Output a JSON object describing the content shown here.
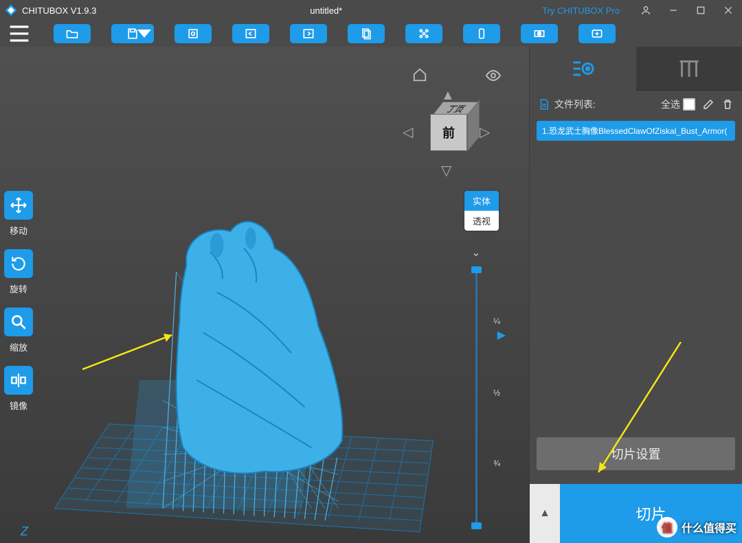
{
  "app": {
    "name": "CHITUBOX V1.9.3",
    "document": "untitled*",
    "tryPro": "Try CHITUBOX Pro"
  },
  "leftTools": {
    "move": "移动",
    "rotate": "旋转",
    "scale": "缩放",
    "mirror": "镜像"
  },
  "viewcube": {
    "front": "前",
    "top": "丁页"
  },
  "viewToggle": {
    "solid": "实体",
    "xray": "透视"
  },
  "slider": {
    "q1": "¼",
    "q2": "½",
    "q3": "¾"
  },
  "axis": {
    "z": "Z"
  },
  "side": {
    "fileListLabel": "文件列表:",
    "selectAll": "全选",
    "file1": "1.恐龙武士胸像BlessedClawOfZiskal_Bust_Armor(",
    "sliceSettings": "切片设置",
    "slice": "切片"
  },
  "watermark": {
    "text": "什么值得买",
    "badge": "值"
  }
}
